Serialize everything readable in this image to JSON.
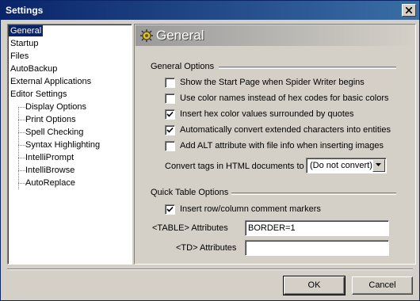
{
  "window": {
    "title": "Settings"
  },
  "tree": {
    "items": [
      {
        "label": "General",
        "selected": true
      },
      {
        "label": "Startup"
      },
      {
        "label": "Files"
      },
      {
        "label": "AutoBackup"
      },
      {
        "label": "External Applications"
      },
      {
        "label": "Editor Settings"
      },
      {
        "label": "Display Options"
      },
      {
        "label": "Print Options"
      },
      {
        "label": "Spell Checking"
      },
      {
        "label": "Syntax Highlighting"
      },
      {
        "label": "IntelliPrompt"
      },
      {
        "label": "IntelliBrowse"
      },
      {
        "label": "AutoReplace"
      }
    ]
  },
  "panel": {
    "heading": "General",
    "general_options": {
      "title": "General Options",
      "checkboxes": [
        {
          "label": "Show the Start Page when Spider Writer begins",
          "checked": false
        },
        {
          "label": "Use color names instead of hex codes for basic colors",
          "checked": false
        },
        {
          "label": "Insert hex color values surrounded by quotes",
          "checked": true
        },
        {
          "label": "Automatically convert extended characters into entities",
          "checked": true
        },
        {
          "label": "Add ALT attribute with file info when inserting images",
          "checked": false
        }
      ],
      "convert_tags_label": "Convert tags in HTML documents to",
      "convert_tags_value": "(Do not convert)"
    },
    "quick_table_options": {
      "title": "Quick Table Options",
      "checkbox": {
        "label": "Insert row/column comment markers",
        "checked": true
      },
      "table_attr_label": "<TABLE> Attributes",
      "table_attr_value": "BORDER=1",
      "td_attr_label": "<TD> Attributes",
      "td_attr_value": ""
    }
  },
  "buttons": {
    "ok": "OK",
    "cancel": "Cancel"
  }
}
